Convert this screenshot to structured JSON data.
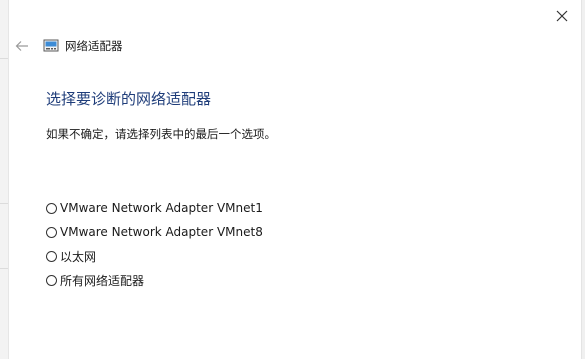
{
  "window": {
    "title": "网络适配器"
  },
  "icons": {
    "back": "back-arrow-icon",
    "close": "close-icon",
    "app": "network-adapter-icon"
  },
  "main": {
    "heading": "选择要诊断的网络适配器",
    "instruction": "如果不确定，请选择列表中的最后一个选项。",
    "options": [
      {
        "label": "VMware Network Adapter VMnet1",
        "selected": false
      },
      {
        "label": "VMware Network Adapter VMnet8",
        "selected": false
      },
      {
        "label": "以太网",
        "selected": false
      },
      {
        "label": "所有网络适配器",
        "selected": false
      }
    ]
  },
  "colors": {
    "heading": "#1f3d7a",
    "background": "#ffffff"
  }
}
